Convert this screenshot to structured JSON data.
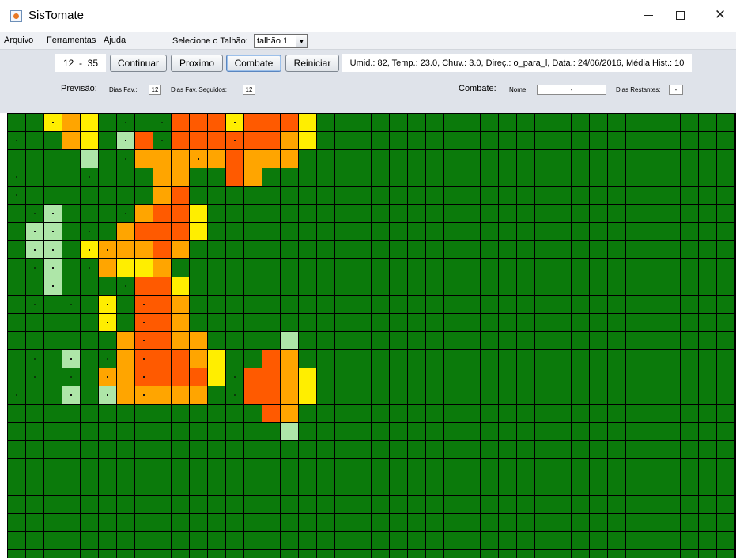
{
  "window": {
    "title": "SisTomate",
    "controls": [
      "minimize",
      "maximize",
      "close"
    ]
  },
  "menu": {
    "items": [
      "Arquivo",
      "Ferramentas",
      "Ajuda"
    ],
    "talhao_label": "Selecione o Talhão:",
    "talhao_value": "talhão 1"
  },
  "toolbar": {
    "range_text": "12  -  35",
    "buttons": [
      "Continuar",
      "Proximo",
      "Combate",
      "Reiniciar"
    ],
    "info_text": "Umid.: 82, Temp.: 23.0, Chuv.: 3.0, Direç.: o_para_l, Data.: 24/06/2016, Média Hist.: 10"
  },
  "previsao": {
    "label": "Previsão:",
    "dias_fav_label": "Dias Fav.:",
    "dias_fav_value": "12",
    "dias_fav_seguidos_label": "Dias Fav. Seguidos:",
    "dias_fav_seguidos_value": "12"
  },
  "combate": {
    "label": "Combate:",
    "nome_label": "Nome:",
    "nome_value": "-",
    "dias_restantes_label": "Dias Restantes:",
    "dias_restantes_value": "-"
  },
  "grid": {
    "columns": 40,
    "rows": 25,
    "level_colors": [
      "#0b7a0b",
      "#aee6a8",
      "#ffee00",
      "#ffa500",
      "#ff5a00",
      "#ff3b14"
    ],
    "cells": [
      [
        0,
        0,
        2,
        3,
        2,
        0,
        0,
        0,
        0,
        4,
        4,
        4,
        2,
        4,
        4,
        4,
        2,
        0,
        0,
        0,
        0,
        0,
        0,
        0,
        0,
        0,
        0,
        0,
        0,
        0,
        0,
        0,
        0,
        0,
        0,
        0,
        0,
        0,
        0,
        0
      ],
      [
        0,
        0,
        0,
        3,
        2,
        0,
        1,
        4,
        0,
        4,
        4,
        4,
        4,
        4,
        4,
        3,
        2,
        0,
        0,
        0,
        0,
        0,
        0,
        0,
        0,
        0,
        0,
        0,
        0,
        0,
        0,
        0,
        0,
        0,
        0,
        0,
        0,
        0,
        0,
        0
      ],
      [
        0,
        0,
        0,
        0,
        1,
        0,
        0,
        3,
        3,
        3,
        3,
        3,
        4,
        3,
        3,
        3,
        0,
        0,
        0,
        0,
        0,
        0,
        0,
        0,
        0,
        0,
        0,
        0,
        0,
        0,
        0,
        0,
        0,
        0,
        0,
        0,
        0,
        0,
        0,
        0
      ],
      [
        0,
        0,
        0,
        0,
        0,
        0,
        0,
        0,
        3,
        3,
        0,
        0,
        4,
        3,
        0,
        0,
        0,
        0,
        0,
        0,
        0,
        0,
        0,
        0,
        0,
        0,
        0,
        0,
        0,
        0,
        0,
        0,
        0,
        0,
        0,
        0,
        0,
        0,
        0,
        0
      ],
      [
        0,
        0,
        0,
        0,
        0,
        0,
        0,
        0,
        3,
        4,
        0,
        0,
        0,
        0,
        0,
        0,
        0,
        0,
        0,
        0,
        0,
        0,
        0,
        0,
        0,
        0,
        0,
        0,
        0,
        0,
        0,
        0,
        0,
        0,
        0,
        0,
        0,
        0,
        0,
        0
      ],
      [
        0,
        0,
        1,
        0,
        0,
        0,
        0,
        3,
        4,
        4,
        2,
        0,
        0,
        0,
        0,
        0,
        0,
        0,
        0,
        0,
        0,
        0,
        0,
        0,
        0,
        0,
        0,
        0,
        0,
        0,
        0,
        0,
        0,
        0,
        0,
        0,
        0,
        0,
        0,
        0
      ],
      [
        0,
        1,
        1,
        0,
        0,
        0,
        3,
        4,
        4,
        4,
        2,
        0,
        0,
        0,
        0,
        0,
        0,
        0,
        0,
        0,
        0,
        0,
        0,
        0,
        0,
        0,
        0,
        0,
        0,
        0,
        0,
        0,
        0,
        0,
        0,
        0,
        0,
        0,
        0,
        0
      ],
      [
        0,
        1,
        1,
        0,
        2,
        3,
        3,
        3,
        4,
        3,
        0,
        0,
        0,
        0,
        0,
        0,
        0,
        0,
        0,
        0,
        0,
        0,
        0,
        0,
        0,
        0,
        0,
        0,
        0,
        0,
        0,
        0,
        0,
        0,
        0,
        0,
        0,
        0,
        0,
        0
      ],
      [
        0,
        0,
        1,
        0,
        0,
        3,
        2,
        2,
        3,
        0,
        0,
        0,
        0,
        0,
        0,
        0,
        0,
        0,
        0,
        0,
        0,
        0,
        0,
        0,
        0,
        0,
        0,
        0,
        0,
        0,
        0,
        0,
        0,
        0,
        0,
        0,
        0,
        0,
        0,
        0
      ],
      [
        0,
        0,
        1,
        0,
        0,
        0,
        0,
        4,
        4,
        2,
        0,
        0,
        0,
        0,
        0,
        0,
        0,
        0,
        0,
        0,
        0,
        0,
        0,
        0,
        0,
        0,
        0,
        0,
        0,
        0,
        0,
        0,
        0,
        0,
        0,
        0,
        0,
        0,
        0,
        0
      ],
      [
        0,
        0,
        0,
        0,
        0,
        2,
        0,
        4,
        4,
        3,
        0,
        0,
        0,
        0,
        0,
        0,
        0,
        0,
        0,
        0,
        0,
        0,
        0,
        0,
        0,
        0,
        0,
        0,
        0,
        0,
        0,
        0,
        0,
        0,
        0,
        0,
        0,
        0,
        0,
        0
      ],
      [
        0,
        0,
        0,
        0,
        0,
        2,
        0,
        4,
        4,
        3,
        0,
        0,
        0,
        0,
        0,
        0,
        0,
        0,
        0,
        0,
        0,
        0,
        0,
        0,
        0,
        0,
        0,
        0,
        0,
        0,
        0,
        0,
        0,
        0,
        0,
        0,
        0,
        0,
        0,
        0
      ],
      [
        0,
        0,
        0,
        0,
        0,
        0,
        3,
        4,
        4,
        3,
        3,
        0,
        0,
        0,
        0,
        1,
        0,
        0,
        0,
        0,
        0,
        0,
        0,
        0,
        0,
        0,
        0,
        0,
        0,
        0,
        0,
        0,
        0,
        0,
        0,
        0,
        0,
        0,
        0,
        0
      ],
      [
        0,
        0,
        0,
        1,
        0,
        0,
        3,
        4,
        4,
        4,
        3,
        2,
        0,
        0,
        4,
        3,
        0,
        0,
        0,
        0,
        0,
        0,
        0,
        0,
        0,
        0,
        0,
        0,
        0,
        0,
        0,
        0,
        0,
        0,
        0,
        0,
        0,
        0,
        0,
        0
      ],
      [
        0,
        0,
        0,
        0,
        0,
        3,
        3,
        4,
        4,
        4,
        4,
        2,
        0,
        4,
        4,
        3,
        2,
        0,
        0,
        0,
        0,
        0,
        0,
        0,
        0,
        0,
        0,
        0,
        0,
        0,
        0,
        0,
        0,
        0,
        0,
        0,
        0,
        0,
        0,
        0
      ],
      [
        0,
        0,
        0,
        1,
        0,
        1,
        3,
        3,
        3,
        3,
        3,
        0,
        0,
        4,
        4,
        3,
        2,
        0,
        0,
        0,
        0,
        0,
        0,
        0,
        0,
        0,
        0,
        0,
        0,
        0,
        0,
        0,
        0,
        0,
        0,
        0,
        0,
        0,
        0,
        0
      ],
      [
        0,
        0,
        0,
        0,
        0,
        0,
        0,
        0,
        0,
        0,
        0,
        0,
        0,
        0,
        4,
        3,
        0,
        0,
        0,
        0,
        0,
        0,
        0,
        0,
        0,
        0,
        0,
        0,
        0,
        0,
        0,
        0,
        0,
        0,
        0,
        0,
        0,
        0,
        0,
        0
      ],
      [
        0,
        0,
        0,
        0,
        0,
        0,
        0,
        0,
        0,
        0,
        0,
        0,
        0,
        0,
        0,
        1,
        0,
        0,
        0,
        0,
        0,
        0,
        0,
        0,
        0,
        0,
        0,
        0,
        0,
        0,
        0,
        0,
        0,
        0,
        0,
        0,
        0,
        0,
        0,
        0
      ],
      [
        0,
        0,
        0,
        0,
        0,
        0,
        0,
        0,
        0,
        0,
        0,
        0,
        0,
        0,
        0,
        0,
        0,
        0,
        0,
        0,
        0,
        0,
        0,
        0,
        0,
        0,
        0,
        0,
        0,
        0,
        0,
        0,
        0,
        0,
        0,
        0,
        0,
        0,
        0,
        0
      ],
      [
        0,
        0,
        0,
        0,
        0,
        0,
        0,
        0,
        0,
        0,
        0,
        0,
        0,
        0,
        0,
        0,
        0,
        0,
        0,
        0,
        0,
        0,
        0,
        0,
        0,
        0,
        0,
        0,
        0,
        0,
        0,
        0,
        0,
        0,
        0,
        0,
        0,
        0,
        0,
        0
      ],
      [
        0,
        0,
        0,
        0,
        0,
        0,
        0,
        0,
        0,
        0,
        0,
        0,
        0,
        0,
        0,
        0,
        0,
        0,
        0,
        0,
        0,
        0,
        0,
        0,
        0,
        0,
        0,
        0,
        0,
        0,
        0,
        0,
        0,
        0,
        0,
        0,
        0,
        0,
        0,
        0
      ],
      [
        0,
        0,
        0,
        0,
        0,
        0,
        0,
        0,
        0,
        0,
        0,
        0,
        0,
        0,
        0,
        0,
        0,
        0,
        0,
        0,
        0,
        0,
        0,
        0,
        0,
        0,
        0,
        0,
        0,
        0,
        0,
        0,
        0,
        0,
        0,
        0,
        0,
        0,
        0,
        0
      ],
      [
        0,
        0,
        0,
        0,
        0,
        0,
        0,
        0,
        0,
        0,
        0,
        0,
        0,
        0,
        0,
        0,
        0,
        0,
        0,
        0,
        0,
        0,
        0,
        0,
        0,
        0,
        0,
        0,
        0,
        0,
        0,
        0,
        0,
        0,
        0,
        0,
        0,
        0,
        0,
        0
      ],
      [
        0,
        0,
        0,
        0,
        0,
        0,
        0,
        0,
        0,
        0,
        0,
        0,
        0,
        0,
        0,
        0,
        0,
        0,
        0,
        0,
        0,
        0,
        0,
        0,
        0,
        0,
        0,
        0,
        0,
        0,
        0,
        0,
        0,
        0,
        0,
        0,
        0,
        0,
        0,
        0
      ],
      [
        0,
        0,
        0,
        0,
        0,
        0,
        0,
        0,
        0,
        0,
        0,
        0,
        0,
        0,
        0,
        0,
        0,
        0,
        0,
        0,
        0,
        0,
        0,
        0,
        0,
        0,
        0,
        0,
        0,
        0,
        0,
        0,
        0,
        0,
        0,
        0,
        0,
        0,
        0,
        0
      ]
    ],
    "markers": [
      [
        0,
        2
      ],
      [
        0,
        6
      ],
      [
        0,
        8
      ],
      [
        0,
        12
      ],
      [
        1,
        0
      ],
      [
        1,
        6
      ],
      [
        1,
        8
      ],
      [
        1,
        12
      ],
      [
        2,
        6
      ],
      [
        2,
        10
      ],
      [
        3,
        0
      ],
      [
        3,
        4
      ],
      [
        4,
        0
      ],
      [
        5,
        1
      ],
      [
        5,
        2
      ],
      [
        5,
        6
      ],
      [
        6,
        1
      ],
      [
        6,
        2
      ],
      [
        6,
        4
      ],
      [
        7,
        1
      ],
      [
        7,
        2
      ],
      [
        7,
        4
      ],
      [
        7,
        5
      ],
      [
        8,
        1
      ],
      [
        8,
        2
      ],
      [
        8,
        4
      ],
      [
        9,
        2
      ],
      [
        9,
        6
      ],
      [
        10,
        1
      ],
      [
        10,
        3
      ],
      [
        10,
        5
      ],
      [
        10,
        7
      ],
      [
        11,
        5
      ],
      [
        11,
        7
      ],
      [
        12,
        7
      ],
      [
        13,
        1
      ],
      [
        13,
        3
      ],
      [
        13,
        5
      ],
      [
        13,
        7
      ],
      [
        14,
        1
      ],
      [
        14,
        3
      ],
      [
        14,
        5
      ],
      [
        14,
        7
      ],
      [
        14,
        12
      ],
      [
        15,
        0
      ],
      [
        15,
        3
      ],
      [
        15,
        5
      ],
      [
        15,
        7
      ],
      [
        15,
        12
      ]
    ]
  }
}
